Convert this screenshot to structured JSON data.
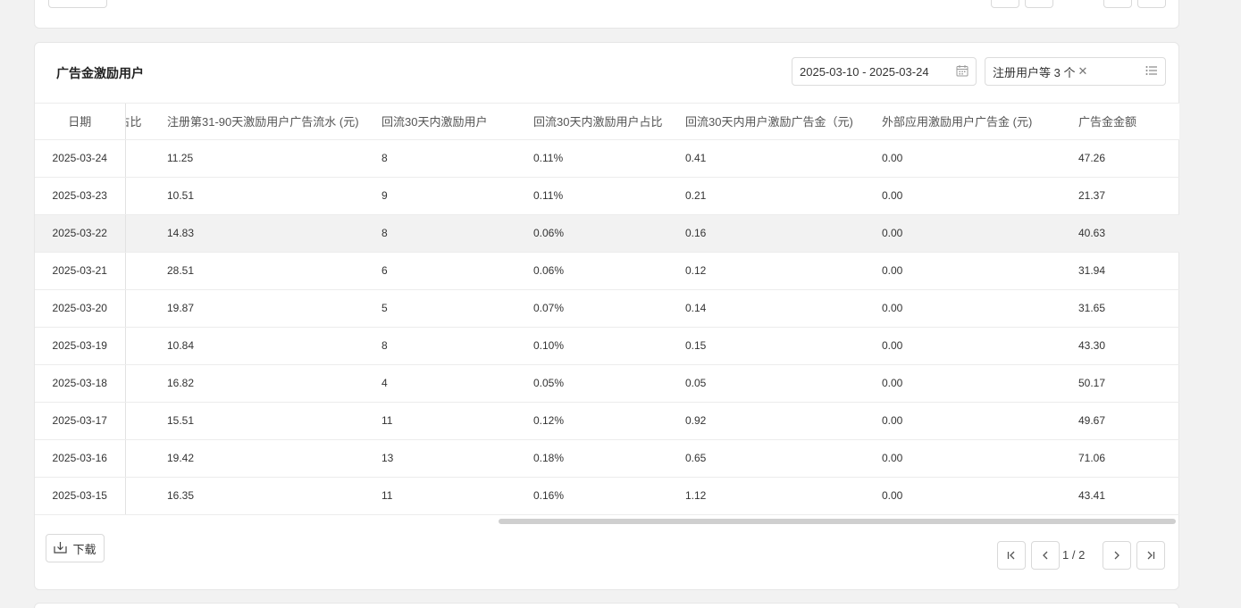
{
  "card": {
    "title": "广告金激励用户",
    "date_range": "2025-03-10 - 2025-03-24",
    "filter_tag": "注册用户等 3 个"
  },
  "table": {
    "columns": [
      "日期",
      "占比",
      "注册第31-90天激励用户广告流水 (元)",
      "回流30天内激励用户",
      "回流30天内激励用户占比",
      "回流30天内用户激励广告金（元)",
      "外部应用激励用户广告金 (元)",
      "广告金金额"
    ],
    "rows": [
      [
        "2025-03-24",
        "",
        "11.25",
        "8",
        "0.11%",
        "0.41",
        "0.00",
        "47.26"
      ],
      [
        "2025-03-23",
        "",
        "10.51",
        "9",
        "0.11%",
        "0.21",
        "0.00",
        "21.37"
      ],
      [
        "2025-03-22",
        "",
        "14.83",
        "8",
        "0.06%",
        "0.16",
        "0.00",
        "40.63"
      ],
      [
        "2025-03-21",
        "",
        "28.51",
        "6",
        "0.06%",
        "0.12",
        "0.00",
        "31.94"
      ],
      [
        "2025-03-20",
        "",
        "19.87",
        "5",
        "0.07%",
        "0.14",
        "0.00",
        "31.65"
      ],
      [
        "2025-03-19",
        "",
        "10.84",
        "8",
        "0.10%",
        "0.15",
        "0.00",
        "43.30"
      ],
      [
        "2025-03-18",
        "",
        "16.82",
        "4",
        "0.05%",
        "0.05",
        "0.00",
        "50.17"
      ],
      [
        "2025-03-17",
        "",
        "15.51",
        "11",
        "0.12%",
        "0.92",
        "0.00",
        "49.67"
      ],
      [
        "2025-03-16",
        "",
        "19.42",
        "13",
        "0.18%",
        "0.65",
        "0.00",
        "71.06"
      ],
      [
        "2025-03-15",
        "",
        "16.35",
        "11",
        "0.16%",
        "1.12",
        "0.00",
        "43.41"
      ]
    ]
  },
  "footer": {
    "download_label": "下载",
    "page_info": "1 / 2"
  },
  "icons": {
    "calendar": "calendar-icon",
    "list": "list-icon",
    "download": "download-icon"
  }
}
